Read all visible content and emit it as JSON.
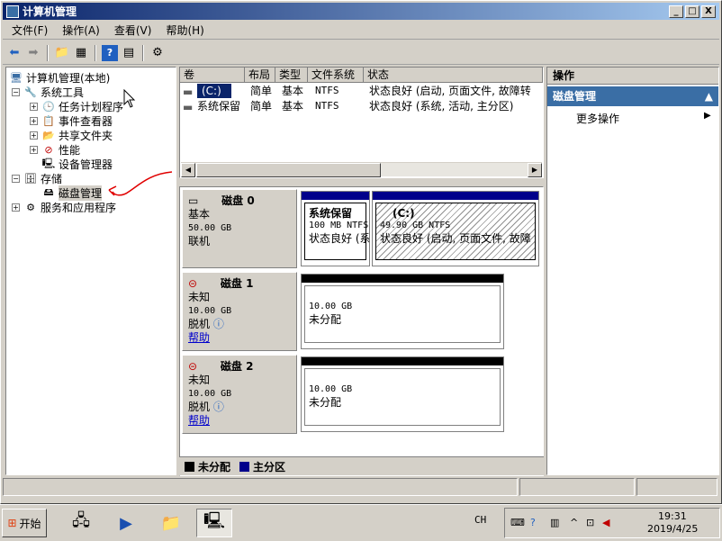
{
  "window": {
    "title": "计算机管理",
    "btn_min": "_",
    "btn_max": "□",
    "btn_close": "X"
  },
  "menu": [
    "文件(F)",
    "操作(A)",
    "查看(V)",
    "帮助(H)"
  ],
  "tree": {
    "root": "计算机管理(本地)",
    "system_tools": "系统工具",
    "task_scheduler": "任务计划程序",
    "event_viewer": "事件查看器",
    "shared_folders": "共享文件夹",
    "performance": "性能",
    "device_manager": "设备管理器",
    "storage": "存储",
    "disk_management": "磁盘管理",
    "services_apps": "服务和应用程序"
  },
  "volumes": {
    "columns": [
      "卷",
      "布局",
      "类型",
      "文件系统",
      "状态"
    ],
    "rows": [
      {
        "vol": "(C:)",
        "layout": "简单",
        "type": "基本",
        "fs": "NTFS",
        "status": "状态良好 (启动, 页面文件, 故障转"
      },
      {
        "vol": "系统保留",
        "layout": "简单",
        "type": "基本",
        "fs": "NTFS",
        "status": "状态良好 (系统, 活动, 主分区)"
      }
    ]
  },
  "disks": [
    {
      "name": "磁盘 0",
      "type": "基本",
      "size": "50.00 GB",
      "state": "联机",
      "parts": [
        {
          "title": "系统保留",
          "size": "100 MB NTFS",
          "status": "状态良好 (系"
        },
        {
          "title": "(C:)",
          "size": "49.90 GB NTFS",
          "status": "状态良好 (启动, 页面文件, 故障"
        }
      ]
    },
    {
      "name": "磁盘 1",
      "type": "未知",
      "size": "10.00 GB",
      "state": "脱机",
      "help": "帮助",
      "parts": [
        {
          "size": "10.00 GB",
          "status": "未分配"
        }
      ]
    },
    {
      "name": "磁盘 2",
      "type": "未知",
      "size": "10.00 GB",
      "state": "脱机",
      "help": "帮助",
      "parts": [
        {
          "size": "10.00 GB",
          "status": "未分配"
        }
      ]
    }
  ],
  "legend": {
    "unallocated": "未分配",
    "primary": "主分区"
  },
  "actions": {
    "header": "操作",
    "section": "磁盘管理",
    "more": "更多操作"
  },
  "taskbar": {
    "start": "开始",
    "ime": "CH",
    "time": "19:31",
    "date": "2019/4/25"
  },
  "colors": {
    "primary_partition": "#00008b",
    "unallocated": "#000000",
    "selection": "#3a6ea5"
  }
}
